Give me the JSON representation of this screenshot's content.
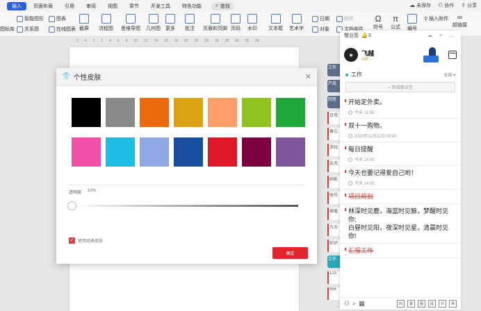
{
  "menubar": {
    "tabs": [
      "插入",
      "页面布局",
      "引用",
      "审阅",
      "视图",
      "章节",
      "开发工具",
      "特色功能"
    ],
    "active_tab": "插入",
    "search_label": "查找",
    "right": [
      "未保存",
      "协作",
      "分享"
    ]
  },
  "ribbon": {
    "items": [
      "智能图形",
      "图表",
      "关系图",
      "在线图表",
      "截屏",
      "流程图",
      "思维导图",
      "几何图",
      "更多",
      "批注",
      "页眉和页脚",
      "页码",
      "水印",
      "文本框",
      "艺术字",
      "日期",
      "附件",
      "对象",
      "文档部件",
      "符号",
      "公式",
      "编号",
      "插入附件",
      "超链接",
      "图标库"
    ]
  },
  "ruler": [
    "6",
    "4",
    "2",
    "2",
    "4",
    "6",
    "8",
    "10",
    "12",
    "14",
    "16",
    "18",
    "20",
    "22",
    "24",
    "26",
    "28",
    "30",
    "32",
    "34"
  ],
  "side_tabs": [
    "工作",
    "产品",
    "回答",
    "日常",
    "备忘",
    "游玩",
    "云充",
    "剧影",
    "账号",
    "输值",
    "九五",
    "知识",
    "工作",
    "123",
    "456"
  ],
  "notes": {
    "header_title": "敬业签",
    "bell_count": "3",
    "user_name": "飞越",
    "vip": "VIP",
    "section": "工作",
    "filter": "全部",
    "add_button": "+ 新增敬业签",
    "items": [
      {
        "text": "开始定外卖。",
        "time": "今天 11:55",
        "color": "#e33",
        "strike": false
      },
      {
        "text": "双十一购物。",
        "time": "2020年11月11日 00:00",
        "color": "#e33",
        "strike": false
      },
      {
        "text": "每日提醒",
        "time": "今天 14:00",
        "color": "#e33",
        "strike": false
      },
      {
        "text": "今天也要记得爱自己哟！",
        "time": "今天 14:55",
        "color": "#e33",
        "strike": false
      },
      {
        "text": "项目规划",
        "time": "",
        "color": "#e33",
        "strike": true
      },
      {
        "text": "林深时见鹿，海蓝时见鲸，梦醒时见你;\n白昼时见阳，夜深时见星，清晨时见你!",
        "time": "",
        "color": "#e33",
        "strike": false
      },
      {
        "text": "汇报工作",
        "time": "",
        "color": "#e33",
        "strike": true
      }
    ],
    "bottom_icons": [
      "user-icon",
      "search-icon",
      "calendar-icon",
      "95",
      "置",
      "图",
      "提",
      "计",
      "钟"
    ]
  },
  "dialog": {
    "title": "个性皮肤",
    "swatches": [
      "#000000",
      "#8a8a8a",
      "#ec6a0c",
      "#dca214",
      "#ff9e69",
      "#8fc31f",
      "#1fa93a",
      "#f24fa6",
      "#1fbde3",
      "#90a7e6",
      "#1a4f9f",
      "#e0192a",
      "#7e0040",
      "#7f559c"
    ],
    "transparency_label": "透明度",
    "transparency_value": "10%",
    "transparency": 0.1,
    "checkbox_label": "使用经典皮肤",
    "checkbox_checked": true,
    "ok_label": "确定"
  }
}
